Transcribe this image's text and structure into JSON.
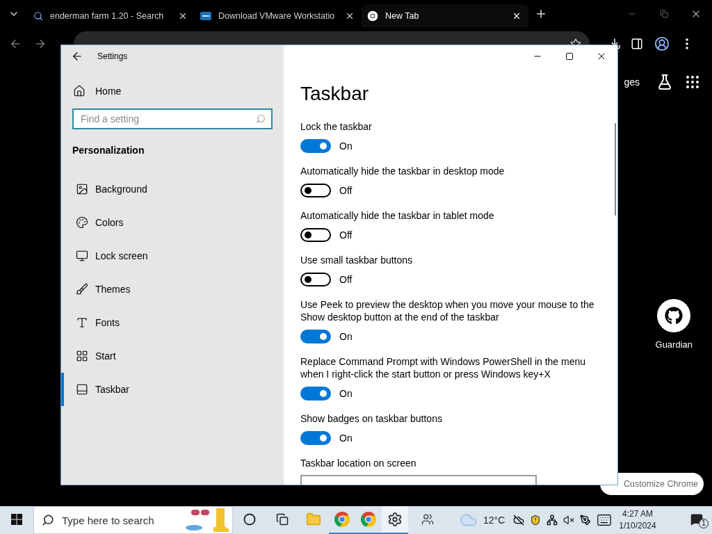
{
  "browser": {
    "tabs": [
      {
        "title": "enderman farm 1.20 - Search",
        "selected": false,
        "kind": "search"
      },
      {
        "title": "Download VMware Workstatio",
        "selected": false,
        "kind": "site"
      },
      {
        "title": "New Tab",
        "selected": true,
        "kind": "newtab"
      }
    ],
    "top_link": "ges",
    "shortcut": {
      "label": "Guardian"
    },
    "customize_button": "Customize Chrome"
  },
  "settings": {
    "title": "Settings",
    "home": "Home",
    "search": {
      "placeholder": "Find a setting"
    },
    "section": "Personalization",
    "nav": [
      {
        "label": "Background",
        "kind": "background",
        "selected": false
      },
      {
        "label": "Colors",
        "kind": "colors",
        "selected": false
      },
      {
        "label": "Lock screen",
        "kind": "lock",
        "selected": false
      },
      {
        "label": "Themes",
        "kind": "themes",
        "selected": false
      },
      {
        "label": "Fonts",
        "kind": "fonts",
        "selected": false
      },
      {
        "label": "Start",
        "kind": "start",
        "selected": false
      },
      {
        "label": "Taskbar",
        "kind": "taskbar",
        "selected": true
      }
    ],
    "page_title": "Taskbar",
    "options": [
      {
        "label": "Lock the taskbar",
        "on": true,
        "state_text": "On"
      },
      {
        "label": "Automatically hide the taskbar in desktop mode",
        "on": false,
        "state_text": "Off"
      },
      {
        "label": "Automatically hide the taskbar in tablet mode",
        "on": false,
        "state_text": "Off"
      },
      {
        "label": "Use small taskbar buttons",
        "on": false,
        "state_text": "Off"
      },
      {
        "label": "Use Peek to preview the desktop when you move your mouse to the Show desktop button at the end of the taskbar",
        "on": true,
        "state_text": "On"
      },
      {
        "label": "Replace Command Prompt with Windows PowerShell in the menu when I right-click the start button or press Windows key+X",
        "on": true,
        "state_text": "On"
      },
      {
        "label": "Show badges on taskbar buttons",
        "on": true,
        "state_text": "On"
      }
    ],
    "next_label": "Taskbar location on screen"
  },
  "taskbar": {
    "search": {
      "placeholder": "Type here to search"
    },
    "apps": [
      {
        "kind": "explorer",
        "running": false,
        "selected": false
      },
      {
        "kind": "chrome",
        "running": true,
        "selected": false
      },
      {
        "kind": "chrome",
        "running": true,
        "selected": false
      },
      {
        "kind": "settings",
        "running": true,
        "selected": true
      }
    ],
    "weather": "12°C",
    "time": "4:27 AM",
    "date": "1/10/2024",
    "notifications": "1"
  }
}
